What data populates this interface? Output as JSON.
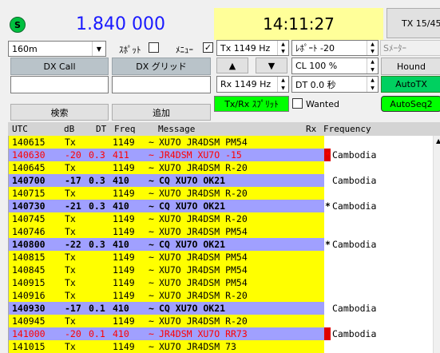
{
  "header": {
    "status_icon_letter": "S",
    "frequency": "1.840 000",
    "time": "14:11:27",
    "tx_period": "TX 15/45"
  },
  "controls": {
    "band": "160m",
    "spot_label": "ｽﾎﾟｯﾄ",
    "menu_label": "ﾒﾆｭｰ",
    "tx_freq": "Tx  1149  Hz",
    "report": "ﾚﾎﾟｰﾄ -20",
    "smeter_label": "Sﾒｰﾀｰ",
    "dx_call_label": "DX Call",
    "dx_grid_label": "DX グリッド",
    "dx_call_value": "",
    "dx_grid_value": "",
    "up_arrow": "▲",
    "down_arrow": "▼",
    "cl_value": "CL  100 %",
    "hound_label": "Hound",
    "rx_freq": "Rx  1149  Hz",
    "dt_value": "DT 0.0 秒",
    "autotx_label": "AutoTX",
    "txrx_split_label": "Tx/Rx ｽﾌﾟﾘｯﾄ",
    "wanted_label": "Wanted",
    "autoseq_label": "AutoSeq2",
    "search_label": "検索",
    "add_label": "追加"
  },
  "table": {
    "headers": [
      "UTC",
      "dB",
      "DT",
      "Freq",
      "Message",
      "Rx",
      "Frequency"
    ],
    "rows": [
      {
        "type": "tx",
        "utc": "140615",
        "db": "Tx",
        "dt": "",
        "freq": "1149",
        "sep": "~",
        "msg": "XU7O JR4DSM PM54",
        "mark": "",
        "country": ""
      },
      {
        "type": "me",
        "utc": "140630",
        "db": "-20",
        "dt": "0.3",
        "freq": "411",
        "sep": "~",
        "msg": "JR4DSM XU7O -15",
        "mark": "*",
        "country": "Cambodia"
      },
      {
        "type": "tx",
        "utc": "140645",
        "db": "Tx",
        "dt": "",
        "freq": "1149",
        "sep": "~",
        "msg": "XU7O JR4DSM R-20",
        "mark": "",
        "country": ""
      },
      {
        "type": "cq",
        "utc": "140700",
        "db": "-17",
        "dt": "0.3",
        "freq": "410",
        "sep": "~",
        "msg": "CQ XU7O OK21",
        "mark": "",
        "country": "Cambodia"
      },
      {
        "type": "tx",
        "utc": "140715",
        "db": "Tx",
        "dt": "",
        "freq": "1149",
        "sep": "~",
        "msg": "XU7O JR4DSM R-20",
        "mark": "",
        "country": ""
      },
      {
        "type": "cq",
        "utc": "140730",
        "db": "-21",
        "dt": "0.3",
        "freq": "410",
        "sep": "~",
        "msg": "CQ XU7O OK21",
        "mark": "*",
        "country": "Cambodia"
      },
      {
        "type": "tx",
        "utc": "140745",
        "db": "Tx",
        "dt": "",
        "freq": "1149",
        "sep": "~",
        "msg": "XU7O JR4DSM R-20",
        "mark": "",
        "country": ""
      },
      {
        "type": "tx",
        "utc": "140746",
        "db": "Tx",
        "dt": "",
        "freq": "1149",
        "sep": "~",
        "msg": "XU7O JR4DSM PM54",
        "mark": "",
        "country": ""
      },
      {
        "type": "cq",
        "utc": "140800",
        "db": "-22",
        "dt": "0.3",
        "freq": "410",
        "sep": "~",
        "msg": "CQ XU7O OK21",
        "mark": "*",
        "country": "Cambodia"
      },
      {
        "type": "tx",
        "utc": "140815",
        "db": "Tx",
        "dt": "",
        "freq": "1149",
        "sep": "~",
        "msg": "XU7O JR4DSM PM54",
        "mark": "",
        "country": ""
      },
      {
        "type": "tx",
        "utc": "140845",
        "db": "Tx",
        "dt": "",
        "freq": "1149",
        "sep": "~",
        "msg": "XU7O JR4DSM PM54",
        "mark": "",
        "country": ""
      },
      {
        "type": "tx",
        "utc": "140915",
        "db": "Tx",
        "dt": "",
        "freq": "1149",
        "sep": "~",
        "msg": "XU7O JR4DSM PM54",
        "mark": "",
        "country": ""
      },
      {
        "type": "tx",
        "utc": "140916",
        "db": "Tx",
        "dt": "",
        "freq": "1149",
        "sep": "~",
        "msg": "XU7O JR4DSM R-20",
        "mark": "",
        "country": ""
      },
      {
        "type": "cq",
        "utc": "140930",
        "db": "-17",
        "dt": "0.1",
        "freq": "410",
        "sep": "~",
        "msg": "CQ XU7O OK21",
        "mark": "",
        "country": "Cambodia"
      },
      {
        "type": "tx",
        "utc": "140945",
        "db": "Tx",
        "dt": "",
        "freq": "1149",
        "sep": "~",
        "msg": "XU7O JR4DSM R-20",
        "mark": "",
        "country": ""
      },
      {
        "type": "me",
        "utc": "141000",
        "db": "-20",
        "dt": "0.1",
        "freq": "410",
        "sep": "~",
        "msg": "JR4DSM XU7O RR73",
        "mark": "",
        "country": "Cambodia"
      },
      {
        "type": "tx",
        "utc": "141015",
        "db": "Tx",
        "dt": "",
        "freq": "1149",
        "sep": "~",
        "msg": "XU7O JR4DSM 73",
        "mark": "",
        "country": ""
      }
    ]
  },
  "colors": {
    "tx_row": "#ffff00",
    "cq_row": "#a0a0ff",
    "my_call_text": "#ff0000",
    "marker_red": "#e00000",
    "green_button": "#00e060",
    "frequency_text": "#1a1aff"
  }
}
